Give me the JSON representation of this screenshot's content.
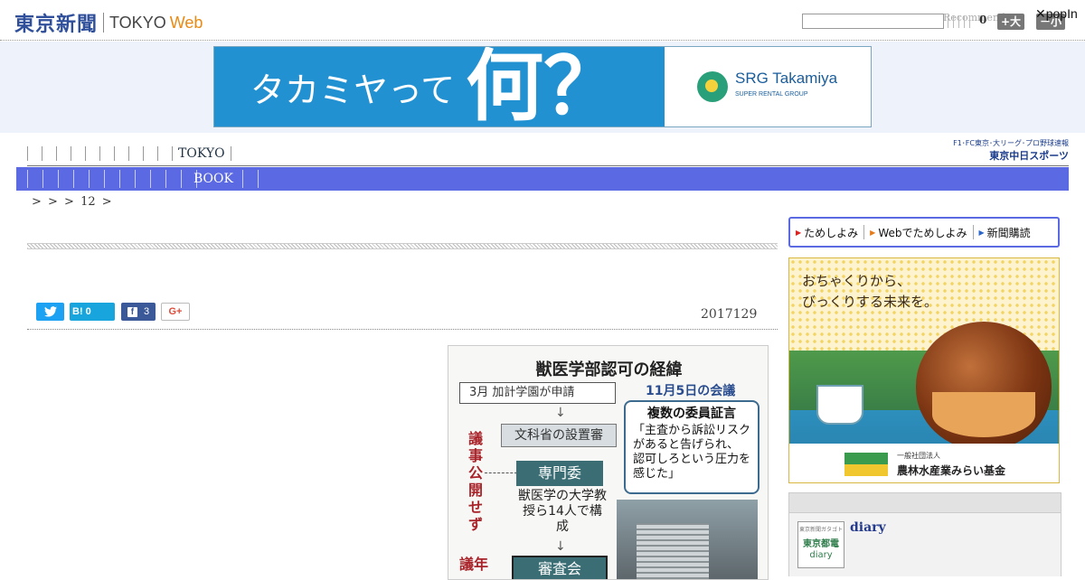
{
  "header": {
    "logo_jp": "東京新聞",
    "logo_tokyo": "TOKYO",
    "logo_web": "Web",
    "search_placeholder": "",
    "recommend_label": "Recommend",
    "counter": "0",
    "font_larger": "+大",
    "font_smaller": "－小",
    "popin": "✕popIn"
  },
  "banner_ad": {
    "headline_small": "タカミヤって",
    "headline_big": "何？",
    "brand": "SRG Takamiya",
    "brand_sub": "SUPER RENTAL GROUP"
  },
  "nav_primary": {
    "tokyo": "TOKYO"
  },
  "sports_link": {
    "top": "F1･FC東京･大リーグ･プロ野球速報",
    "bottom": "東京中日スポーツ"
  },
  "nav_secondary": {
    "book": "BOOK"
  },
  "breadcrumb": "> > > 12 >",
  "article": {
    "share_twitter_icon": "twitter-bird",
    "share_hatena": "B!",
    "share_hatena_count": "0",
    "share_facebook_count": "3",
    "share_google": "G+",
    "date": "2017129"
  },
  "figure": {
    "title": "獣医学部認可の経緯",
    "march": "3月  加計学園が申請",
    "meeting": "11月5日の会議",
    "testimony_head": "複数の委員証言",
    "testimony_body": "「主査から訴訟リスクがあると告げられ、認可しろという圧力を感じた」",
    "arrow": "↓",
    "council": "文科省の設置審",
    "committee": "専門委",
    "side_label": "議事公開せず",
    "members": "獣医学の大学教授ら14人で構成",
    "side_label2": "議年",
    "review": "審査会"
  },
  "sidebar": {
    "tabs": [
      "ためしよみ",
      "Webでためしよみ",
      "新聞購読"
    ],
    "ad_text_line1": "おちゃくりから、",
    "ad_text_line2": "びっくりする未来を。",
    "ad_org_small": "一般社団法人",
    "ad_org": "農林水産業みらい基金",
    "diary_thumb_top": "東京新聞ガタゴト",
    "diary_thumb_mid": "東京都電",
    "diary_thumb_bot": "diary",
    "diary_link": "diary"
  },
  "colors": {
    "nav_blue": "#5b69e2",
    "logo_blue": "#2f4f9a",
    "web_orange": "#e98a14",
    "ad_blue": "#2291d2"
  }
}
